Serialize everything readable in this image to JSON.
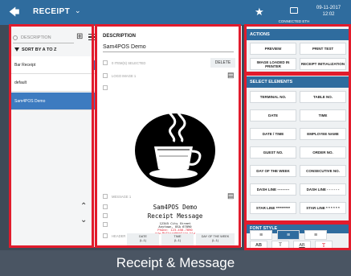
{
  "topbar": {
    "back_icon": "arrow-left-icon",
    "title": "RECEIPT",
    "star_icon": "star-icon",
    "connection_label": "CONNECTED ETH",
    "date": "09-11-2017",
    "time": "12:02"
  },
  "left": {
    "search_placeholder": "DESCRIPTION",
    "sort_label": "SORT BY A TO Z",
    "items": [
      "Bar Receipt",
      "default",
      "Sam4POS Demo"
    ],
    "selected_index": 2
  },
  "middle": {
    "description_label": "DESCRIPTION",
    "description_value": "Sam4POS Demo",
    "selected_count": "0 ITEM(S) SELECTED",
    "delete_label": "DELETE",
    "logo_label": "LOGO IMAGE 1",
    "message_label": "MESSAGE 1",
    "header_label": "HEADER",
    "receipt_lines": [
      "Sam4POS Demo",
      "Receipt Message"
    ],
    "address_lines": [
      "12345 City Street",
      "Anytown, USA 67890"
    ],
    "phone_line": "Phone: 123-456-7890",
    "web_line": "www.MyStoreWebSite.biz",
    "footer_buttons": [
      {
        "top": "DATE",
        "bottom": "(L-1)"
      },
      {
        "top": "TIME",
        "bottom": "(L-1)"
      },
      {
        "top": "DAY OF THE WEEK",
        "bottom": "(L-1)"
      }
    ]
  },
  "actions": {
    "header": "ACTIONS",
    "buttons": [
      "PREVIEW",
      "PRINT TEST",
      "IMAGE LOADED IN PRINTER",
      "RECEIPT INITIALIZATION"
    ]
  },
  "select_elements": {
    "header": "SELECT ELEMENTS",
    "buttons": [
      "TERMINAL NO.",
      "TABLE NO.",
      "DATE",
      "TIME",
      "DATE / TIME",
      "EMPLOYEE NAME",
      "GUEST NO.",
      "ORDER NO.",
      "DAY OF THE WEEK",
      "CONSECUTIVE NO.",
      "DASH LINE ----------",
      "DASH LINE - - - - - -",
      "STAR LINE **********",
      "STAR LINE * * * * * *"
    ]
  },
  "font_style": {
    "header": "FONT STYLE",
    "align_icons": [
      "align-left-icon",
      "align-center-icon",
      "align-right-icon"
    ],
    "active_align_index": 1,
    "style_buttons": [
      "AB",
      "T",
      "AB",
      "T"
    ],
    "accent_color": "#e21b2c"
  },
  "caption": "Receipt & Message",
  "colors": {
    "brand_blue": "#2f6c9e",
    "selection_blue": "#3d7bc0",
    "highlight_red": "#e21b2c"
  }
}
